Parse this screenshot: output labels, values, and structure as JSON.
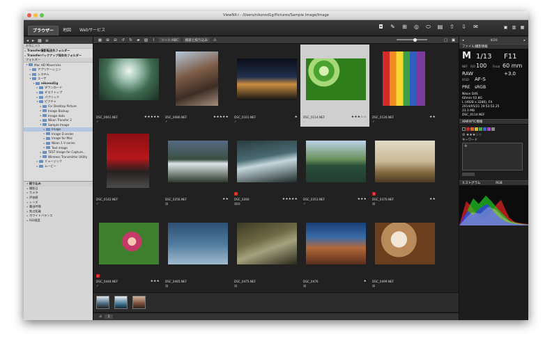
{
  "window": {
    "title": "ViewNX-i - /Users/nikonsd1g/Pictures/Sample Image/Image"
  },
  "tabs": [
    {
      "label": "ブラウザー",
      "active": true
    },
    {
      "label": "地図",
      "active": false
    },
    {
      "label": "Webサービス",
      "active": false
    }
  ],
  "sidebar": {
    "favorites_head": "お気に入り",
    "favorites": [
      "Transfer撮影転送先フォルダー",
      "Transferバックアップ保存先フォルダー"
    ],
    "folders_head": "フォルダー",
    "tree": [
      {
        "label": "Mac HD Mavericks",
        "level": 0,
        "open": true
      },
      {
        "label": "アプリケーション",
        "level": 1
      },
      {
        "label": "システム",
        "level": 1
      },
      {
        "label": "ユーザ",
        "level": 1,
        "open": true
      },
      {
        "label": "nikonsd1g",
        "level": 2,
        "open": true,
        "bold": true
      },
      {
        "label": "ダウンロード",
        "level": 3
      },
      {
        "label": "デスクトップ",
        "level": 3
      },
      {
        "label": "パブリック",
        "level": 3
      },
      {
        "label": "ピクチャ",
        "level": 3,
        "open": true
      },
      {
        "label": "For Desktop Picture",
        "level": 4
      },
      {
        "label": "Image Backup",
        "level": 4
      },
      {
        "label": "Image data",
        "level": 4
      },
      {
        "label": "Nikon Transfer 2",
        "level": 4
      },
      {
        "label": "Sample Image",
        "level": 4,
        "open": true
      },
      {
        "label": "Image",
        "level": 5,
        "selected": true
      },
      {
        "label": "Image D series",
        "level": 5
      },
      {
        "label": "Image for Mac",
        "level": 5
      },
      {
        "label": "Nikon 1 V series",
        "level": 5
      },
      {
        "label": "Text image",
        "level": 5
      },
      {
        "label": "TEST Image for Capture...",
        "level": 4
      },
      {
        "label": "Wireless Transmitter Utility",
        "level": 4
      },
      {
        "label": "ミュージック",
        "level": 3
      },
      {
        "label": "ムービー",
        "level": 3
      }
    ],
    "filter_head": "絞り込み",
    "filters": [
      "撮影日",
      "カメラ",
      "評価値",
      "レンズ",
      "露出時間",
      "焦点距離",
      "ホワイトバランス",
      "ISO感度"
    ]
  },
  "toolbar": {
    "sort_label": "ソート:ABC",
    "search_label": "検索と絞り込み"
  },
  "thumbnails": [
    {
      "name": "DSC_0061.NEF",
      "stars": "★★★★★",
      "sub": "✓"
    },
    {
      "name": "DSC_0080.NEF",
      "stars": "★★★★★",
      "sub": "✓"
    },
    {
      "name": "DSC_0101.NEF",
      "stars": "★",
      "sub": "✓"
    },
    {
      "name": "DSC_0114.NEF",
      "stars": "★★★☆☆",
      "sub": "✓",
      "selected": true
    },
    {
      "name": "DSC_0126.NEF",
      "stars": "★★",
      "sub": "✓"
    },
    {
      "name": "DSC_0142.NEF",
      "stars": "",
      "sub": "✓"
    },
    {
      "name": "DSC_0256.NEF",
      "stars": "★★",
      "sub": "▤"
    },
    {
      "name": "DSC_0260",
      "stars": "★★★★★",
      "sub": "▤▤",
      "badge": "!"
    },
    {
      "name": "DSC_0353.NEF",
      "stars": "★★★",
      "sub": "✓"
    },
    {
      "name": "DSC_0370.NEF",
      "stars": "★★",
      "sub": "▤",
      "badge": "!"
    },
    {
      "name": "DSC_0444.NEF",
      "stars": "★★★",
      "sub": "✓",
      "badge": "!"
    },
    {
      "name": "DSC_0465.NEF",
      "stars": "",
      "sub": "▤"
    },
    {
      "name": "DSC_0475.NEF",
      "stars": "",
      "sub": "▤"
    },
    {
      "name": "DSC_0476",
      "stars": "★",
      "sub": "▤"
    },
    {
      "name": "DSC_0499.NEF",
      "stars": "",
      "sub": "▤"
    }
  ],
  "bottom": {
    "page": "1"
  },
  "panel": {
    "counter": "4/20",
    "exif_head": "ファイル/撮影情報",
    "exif": {
      "mode": "M",
      "shutter": "1/13",
      "aperture": "F11",
      "iso_label": "ISO",
      "iso": "100",
      "focal_label": "Focal",
      "focal": "60 mm",
      "ev": "+3.0",
      "raw": "RAW",
      "afs": "AF-S",
      "pre": "PRE",
      "srgb": "sRGB",
      "camera": "Nikon D4S",
      "lens": "60mm f/2.8G",
      "size": "L (4928 x 3280), FX",
      "date": "2014/05/21 19:53:52.25",
      "filesize": "23.1 MB",
      "file": "DSC_0114.NEF"
    },
    "xmp_head": "XMP/IPTC情報",
    "xmp_keyword_label": "キーワード",
    "hist_head": "ヒストグラム",
    "hist_mode": "RGB"
  }
}
